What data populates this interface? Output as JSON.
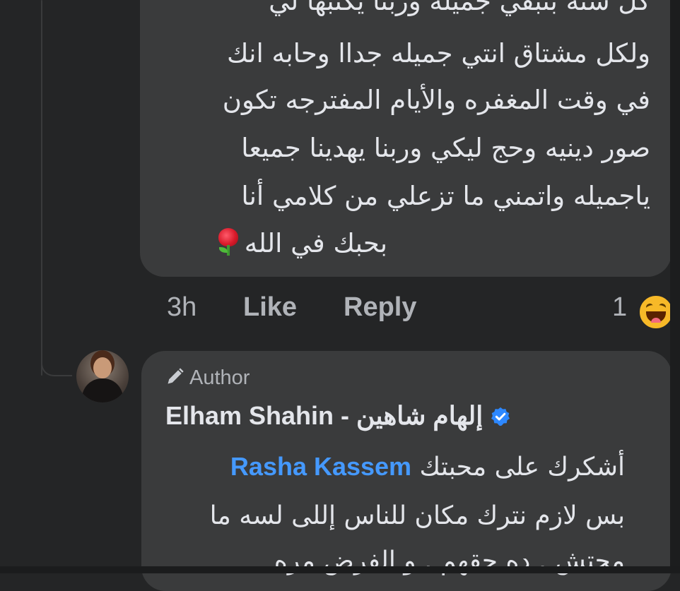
{
  "top_comment": {
    "lines": [
      "كل سنة بتبقي جميله وربنا يكتبها لي",
      "ولكل مشتاق انتي جميله جداا وحابه انك",
      "في وقت المغفره والأيام المفترجه تكون",
      "صور دينيه وحج ليكي وربنا يهدينا جميعا",
      "ياجميله واتمني ما تزعلي من كلامي أنا",
      "بحبك في الله"
    ],
    "trailing_emoji": "rose-icon"
  },
  "actions": {
    "time": "3h",
    "like": "Like",
    "reply": "Reply",
    "reaction_count": "1",
    "reaction_icon": "haha-icon"
  },
  "reply": {
    "badge": "Author",
    "author": "Elham Shahin - إلهام شاهين",
    "verified": true,
    "mention": "Rasha Kassem",
    "line1_text": "أشكرك على محبتك",
    "line2": "بس لازم نترك مكان للناس إللى لسه ما",
    "line3": "محتش . ده حقهم . و الفرض مره"
  },
  "colors": {
    "background": "#242526",
    "bubble": "#3a3b3c",
    "text": "#e4e6eb",
    "secondary_text": "#b0b3b8",
    "mention": "#4599ff",
    "verified": "#2d88ff"
  }
}
